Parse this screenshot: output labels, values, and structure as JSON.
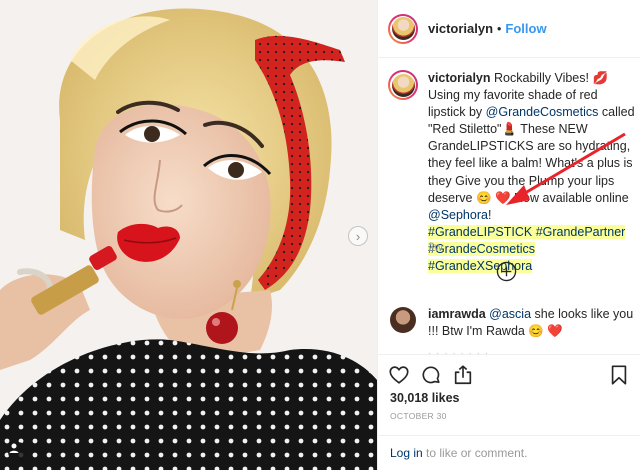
{
  "post": {
    "username": "victorialyn",
    "separator": "•",
    "follow_label": "Follow",
    "caption": {
      "username": "victorialyn",
      "p1": "Rockabilly Vibes! 💋 Using my favorite shade of red lipstick by ",
      "mention1": "@GrandeCosmetics",
      "p2": " called \"Red Stiletto\"💄 These NEW GrandeLIPSTICKS are so hydrating, they feel like a balm! What's a plus is they Give you the Plump your lips deserve 😊 ❤️  Now available online ",
      "mention2": "@Sephora",
      "p3": "!",
      "hashtags_line1": "#GrandeLIPSTICK #GrandePartner",
      "hashtags_line2": "#GrandeCosmetics #GrandeXSephora"
    },
    "age": "2w",
    "comment": {
      "username": "iamrawda",
      "mention": "@ascia",
      "text": " she looks like you !!! Btw I'm Rawda 😊 ❤️"
    },
    "likes": "30,018 likes",
    "date": "OCTOBER 30",
    "login_link": "Log in",
    "login_rest": " to like or comment."
  },
  "icons": {
    "like": "heart-icon",
    "comment": "speech-bubble-icon",
    "share": "share-icon",
    "save": "bookmark-icon",
    "load_more": "plus-circle-icon",
    "next": "chevron-right-icon",
    "tag": "user-tag-icon"
  },
  "colors": {
    "follow": "#3897f0",
    "mention": "#003569",
    "highlight": "#fbff9a",
    "annotation_arrow": "#e8232a",
    "muted": "#999999"
  }
}
